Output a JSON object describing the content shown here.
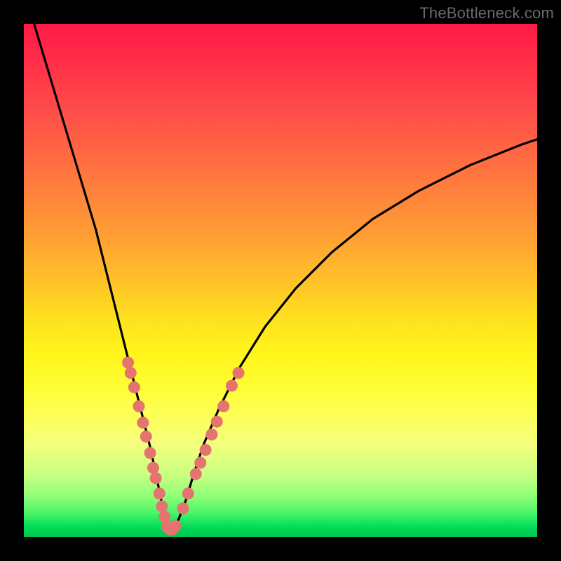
{
  "watermark": "TheBottleneck.com",
  "colors": {
    "frame": "#000000",
    "curve_stroke": "#000000",
    "dot_fill": "#e5736f",
    "gradient_top": "#ff1a46",
    "gradient_bottom": "#00c84f"
  },
  "chart_data": {
    "type": "line",
    "title": "",
    "xlabel": "",
    "ylabel": "",
    "xlim": [
      0,
      100
    ],
    "ylim": [
      0,
      100
    ],
    "note": "V-shaped bottleneck curve on red→green vertical gradient; values estimated from pixel positions on a 732×732 plot area (distinct from the overall 800×800 image). y = 100 at top, 0 at bottom; x = 0 left, 100 right.",
    "series": [
      {
        "name": "curve",
        "x": [
          2,
          5,
          8,
          11,
          14,
          16,
          18,
          20,
          21.5,
          23,
          24.5,
          25.8,
          26.8,
          27.6,
          28.2,
          28.7,
          29.3,
          30.2,
          31.5,
          33,
          35,
          38,
          42,
          47,
          53,
          60,
          68,
          77,
          87,
          97,
          100
        ],
        "y": [
          100,
          90,
          80,
          70,
          60,
          52,
          44,
          36,
          30,
          24,
          18,
          12,
          7,
          3.6,
          1.8,
          1.4,
          1.8,
          3.6,
          7,
          12,
          18,
          25,
          33,
          41,
          48.5,
          55.5,
          62,
          67.5,
          72.5,
          76.5,
          77.5
        ]
      },
      {
        "name": "dots-left",
        "x": [
          20.3,
          20.8,
          21.5,
          22.4,
          23.2,
          23.8,
          24.6,
          25.2,
          25.7,
          26.4,
          26.9,
          27.4
        ],
        "y": [
          34.0,
          32.0,
          29.2,
          25.5,
          22.3,
          19.6,
          16.4,
          13.5,
          11.5,
          8.5,
          6.0,
          4.0
        ]
      },
      {
        "name": "dots-bottom",
        "x": [
          27.9,
          28.4,
          28.9,
          29.5
        ],
        "y": [
          2.0,
          1.5,
          1.5,
          2.2
        ]
      },
      {
        "name": "dots-right",
        "x": [
          31.0,
          32.0,
          33.5,
          34.4,
          35.4,
          36.6,
          37.6,
          38.9,
          40.5,
          41.8
        ],
        "y": [
          5.6,
          8.5,
          12.3,
          14.5,
          17.0,
          20.0,
          22.5,
          25.5,
          29.5,
          32.0
        ]
      }
    ]
  }
}
